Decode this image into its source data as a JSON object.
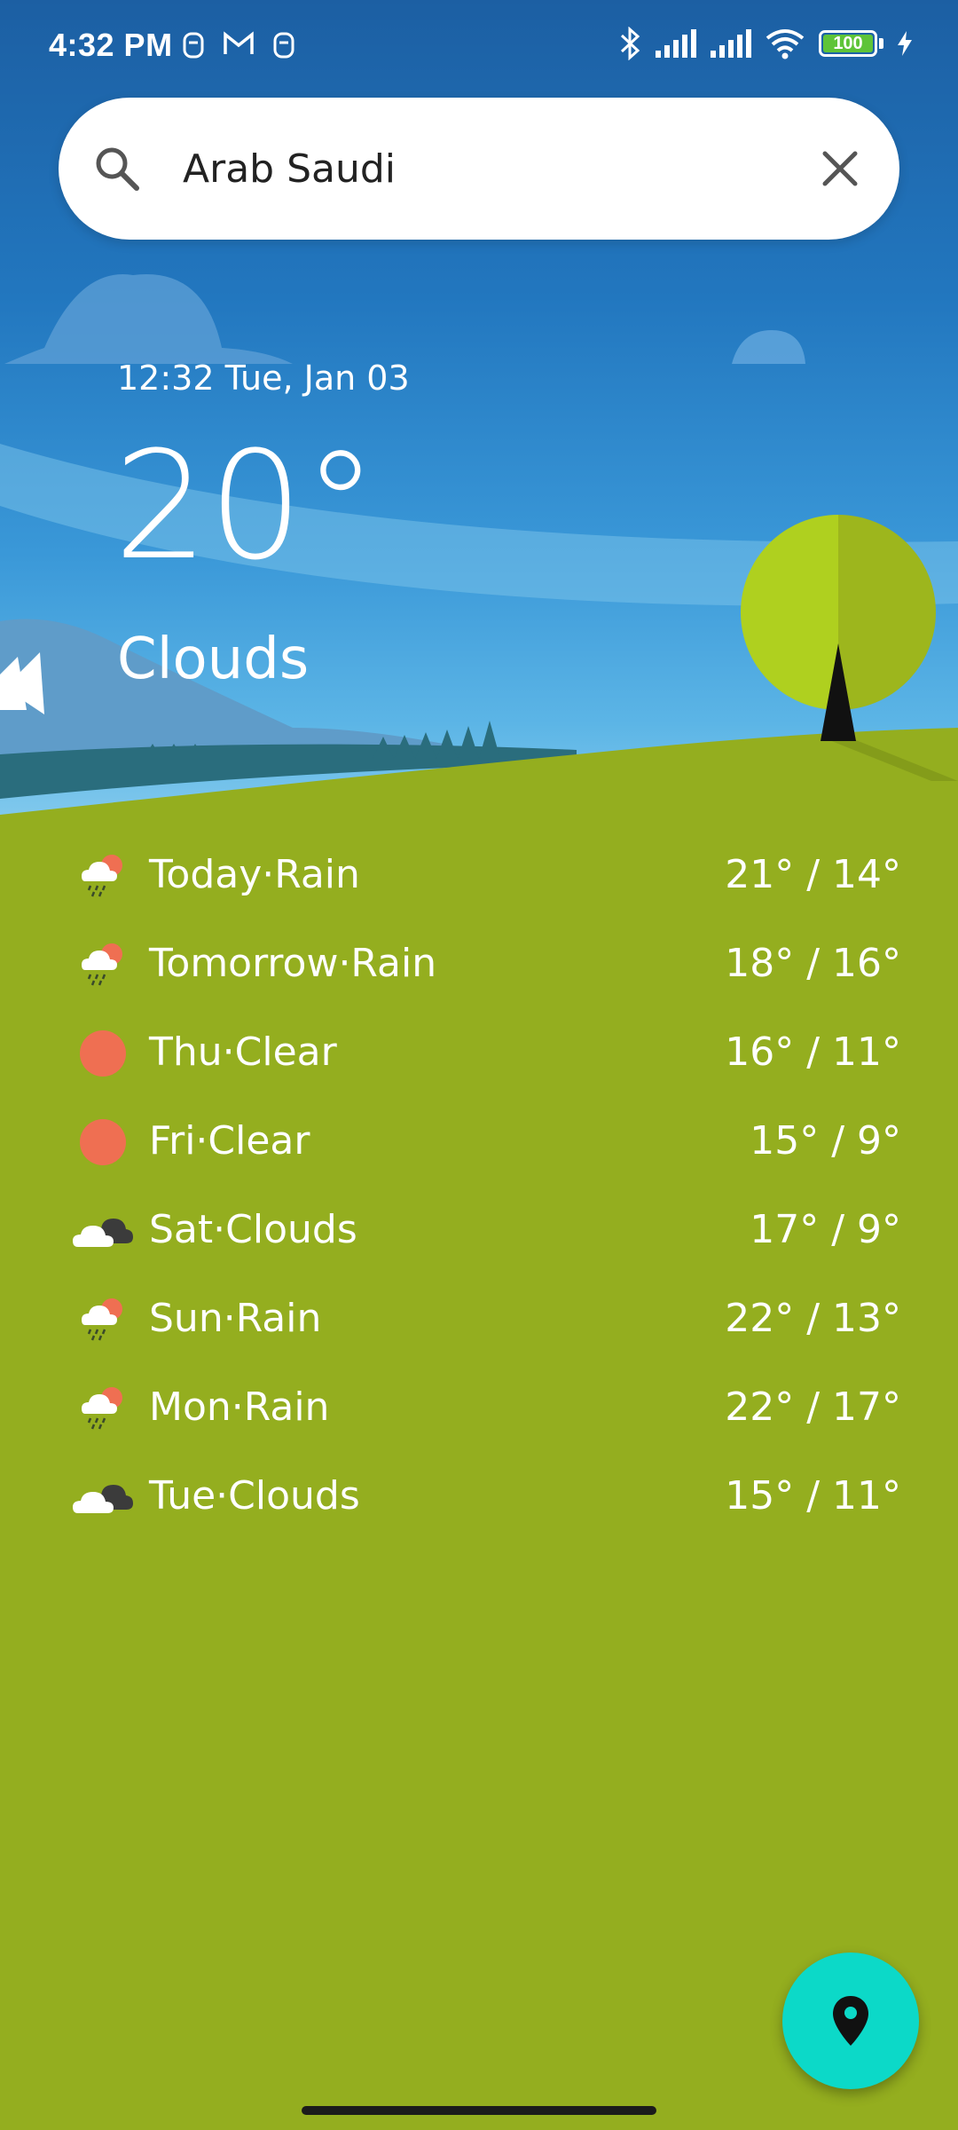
{
  "status_bar": {
    "time": "4:32 PM",
    "battery_level": "100",
    "icons": [
      "notification-icon",
      "gmail-icon",
      "notification-icon",
      "bluetooth-icon",
      "signal-icon",
      "signal-icon",
      "wifi-icon",
      "charging-icon"
    ]
  },
  "search": {
    "value": "Arab Saudi",
    "placeholder": ""
  },
  "current": {
    "datetime": "12:32 Tue, Jan 03",
    "temperature": "20°",
    "condition": "Clouds"
  },
  "forecast": [
    {
      "label": "Today·Rain",
      "temps": "21° / 14°",
      "icon": "rain"
    },
    {
      "label": "Tomorrow·Rain",
      "temps": "18° / 16°",
      "icon": "rain"
    },
    {
      "label": "Thu·Clear",
      "temps": "16° / 11°",
      "icon": "clear"
    },
    {
      "label": "Fri·Clear",
      "temps": "15° / 9°",
      "icon": "clear"
    },
    {
      "label": "Sat·Clouds",
      "temps": "17° / 9°",
      "icon": "clouds"
    },
    {
      "label": "Sun·Rain",
      "temps": "22° / 13°",
      "icon": "rain"
    },
    {
      "label": "Mon·Rain",
      "temps": "22° / 17°",
      "icon": "rain"
    },
    {
      "label": "Tue·Clouds",
      "temps": "15° / 11°",
      "icon": "clouds"
    }
  ],
  "colors": {
    "sky_top": "#1c5fa3",
    "ground": "#94ae1f",
    "fab": "#0cd9c8",
    "sun": "#ef6f52"
  }
}
